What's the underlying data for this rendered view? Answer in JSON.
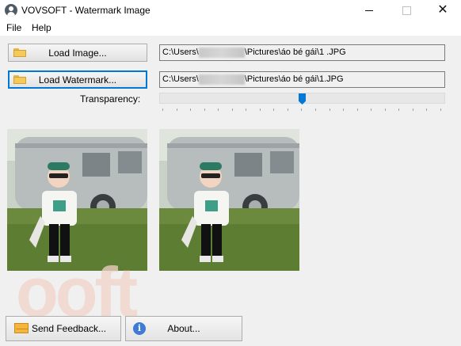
{
  "window": {
    "title": "VOVSOFT - Watermark Image"
  },
  "menu": {
    "file": "File",
    "help": "Help"
  },
  "load_image": {
    "label": "Load Image...",
    "path_prefix": "C:\\Users\\",
    "path_suffix": "\\Pictures\\áo bé gái\\1 .JPG"
  },
  "load_watermark": {
    "label": "Load Watermark...",
    "path_prefix": "C:\\Users\\",
    "path_suffix": "\\Pictures\\áo bé gái\\1.JPG"
  },
  "transparency": {
    "label": "Transparency:",
    "value_fraction": 0.5
  },
  "watermark_overlay": "ooft",
  "buttons": {
    "feedback": "Send Feedback...",
    "about": "About..."
  },
  "icons": {
    "app": "user-circle-icon",
    "folder": "folder-icon",
    "mail": "envelope-icon",
    "info": "info-icon"
  },
  "colors": {
    "accent": "#0078d7",
    "background": "#f0f0f0"
  }
}
